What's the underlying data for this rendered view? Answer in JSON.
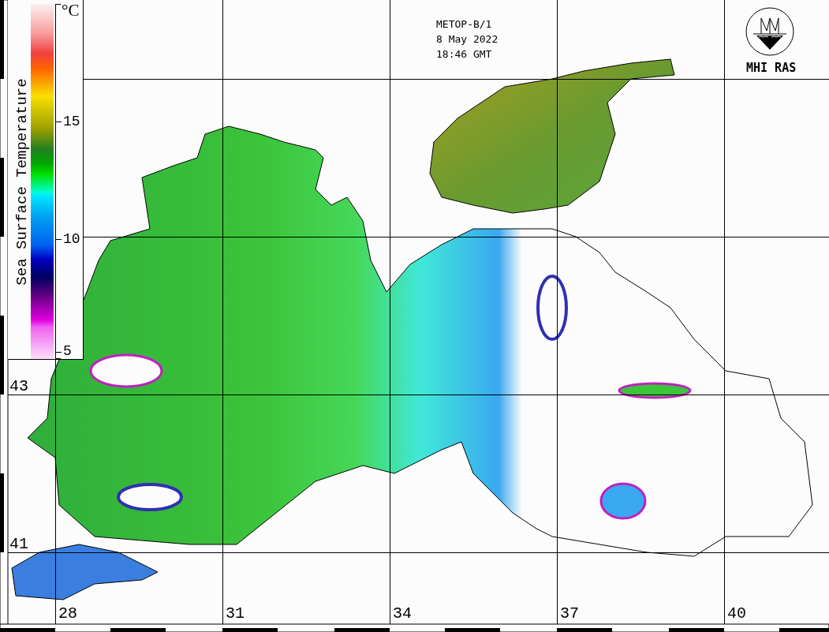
{
  "colorbar": {
    "title": "Sea Surface Temperature",
    "unit": "°C",
    "ticks": [
      "15",
      "10",
      "5"
    ]
  },
  "header": {
    "lines": [
      "METOP-B/1",
      "8 May 2022",
      "18:46 GMT"
    ]
  },
  "logo": {
    "label": "MHI RAS"
  },
  "map": {
    "latitude_labels": [
      "43",
      "41"
    ],
    "longitude_labels": [
      "28",
      "31",
      "34",
      "37",
      "40"
    ]
  }
}
